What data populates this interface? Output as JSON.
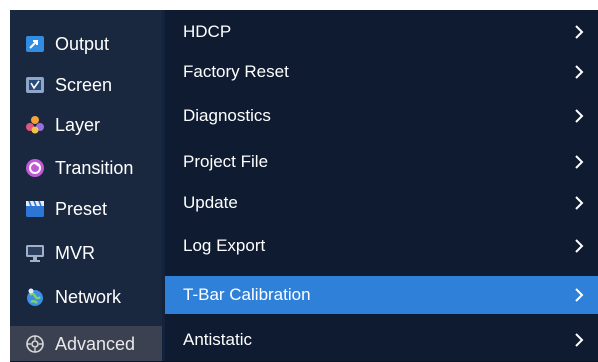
{
  "sidebar": {
    "items": [
      {
        "label": "Output",
        "icon": "output-icon"
      },
      {
        "label": "Screen",
        "icon": "screen-icon"
      },
      {
        "label": "Layer",
        "icon": "layer-icon"
      },
      {
        "label": "Transition",
        "icon": "transition-icon"
      },
      {
        "label": "Preset",
        "icon": "preset-icon"
      },
      {
        "label": "MVR",
        "icon": "monitor-icon"
      },
      {
        "label": "Network",
        "icon": "network-icon"
      },
      {
        "label": "Advanced",
        "icon": "gear-icon",
        "active": true
      }
    ]
  },
  "submenu": {
    "items": [
      {
        "label": "HDCP"
      },
      {
        "label": "Factory Reset"
      },
      {
        "label": "Diagnostics"
      },
      {
        "label": "Project File"
      },
      {
        "label": "Update"
      },
      {
        "label": "Log Export"
      },
      {
        "label": "T-Bar Calibration",
        "highlighted": true
      },
      {
        "label": "Antistatic"
      }
    ]
  },
  "colors": {
    "panel_bg": "#14233d",
    "sidebar_bg": "#19283f",
    "submenu_bg": "#0e1b31",
    "highlight": "#2f80d9",
    "active_nav": "#3b4150",
    "text": "#ffffff"
  }
}
